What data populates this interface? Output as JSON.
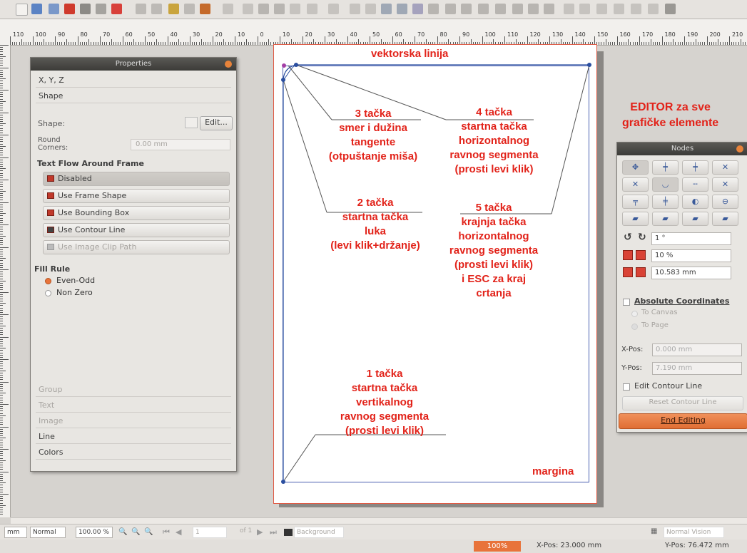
{
  "canvas": {
    "annotations": {
      "title": "vektorska linija",
      "editor": "EDITOR za sve\ngrafičke elemente",
      "t1": "1 tačka\nstartna tačka\nvertikalnog\nravnog segmenta\n(prosti levi klik)",
      "t2": "2 tačka\nstartna tačka\nluka\n(levi klik+držanje)",
      "t3": "3 tačka\nsmer i dužina\ntangente\n(otpuštanje miša)",
      "t4": "4 tačka\nstartna tačka\nhorizontalnog\nravnog segmenta\n(prosti levi klik)",
      "t5": "5 tačka\nkrajnja tačka\nhorizontalnog\nravnog segmenta\n(prosti levi klik)\ni ESC za kraj\ncrtanja",
      "margin": "margina"
    }
  },
  "properties": {
    "title": "Properties",
    "sections": {
      "xyz": "X, Y, Z",
      "shape": "Shape"
    },
    "shape_label": "Shape:",
    "edit_button": "Edit...",
    "round_corners_label": "Round\nCorners:",
    "round_corners_value": "0.00 mm",
    "text_flow_heading": "Text Flow Around Frame",
    "text_flow_buttons": [
      "Disabled",
      "Use Frame Shape",
      "Use Bounding Box",
      "Use Contour Line",
      "Use Image Clip Path"
    ],
    "fill_rule_heading": "Fill Rule",
    "fill_rule_options": [
      "Even-Odd",
      "Non Zero"
    ],
    "bottom_sections": [
      "Group",
      "Text",
      "Image",
      "Line",
      "Colors"
    ]
  },
  "nodes": {
    "title": "Nodes",
    "rotation_value": "1 °",
    "scale_value": "10 %",
    "size_value": "10.583 mm",
    "absolute_coordinates": "Absolute Coordinates",
    "to_canvas": "To Canvas",
    "to_page": "To Page",
    "xpos_label": "X-Pos:",
    "xpos_value": "0.000 mm",
    "ypos_label": "Y-Pos:",
    "ypos_value": "7.190 mm",
    "edit_contour": "Edit Contour Line",
    "reset_contour": "Reset Contour Line",
    "end_editing": "End Editing"
  },
  "bottombar": {
    "unit": "mm",
    "mode": "Normal",
    "zoom": "100.00 %",
    "page_num": "1",
    "page_of": "of 1",
    "layer": "Background",
    "view_mode": "Normal Vision"
  },
  "status": {
    "zoom_badge": "100%",
    "xpos": "X-Pos: 23.000 mm",
    "ypos": "Y-Pos: 76.472 mm"
  },
  "ruler_labels": [
    "110",
    "100",
    "90",
    "80",
    "70",
    "60",
    "50",
    "40",
    "30",
    "20",
    "10",
    "0",
    "10",
    "20",
    "30",
    "40",
    "50",
    "60",
    "70",
    "80",
    "90",
    "100",
    "110",
    "120",
    "130",
    "140",
    "150",
    "160",
    "170",
    "180",
    "190",
    "200",
    "210"
  ],
  "colors": {
    "annotation_red": "#e2231a",
    "node_blue": "#2b4fa0",
    "accent_orange": "#e8733a"
  }
}
